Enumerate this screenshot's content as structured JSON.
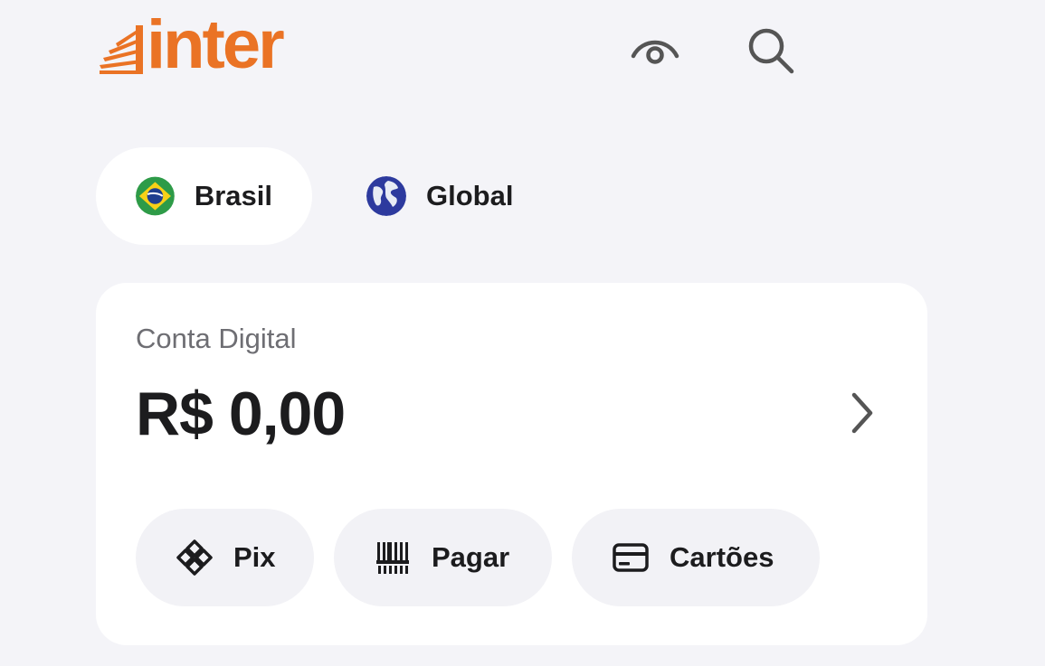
{
  "header": {
    "logo_text": "inter",
    "brand_color": "#EA7325",
    "icons": [
      "eye-icon",
      "search-icon"
    ]
  },
  "regions": [
    {
      "label": "Brasil",
      "icon": "brazil-flag-icon",
      "active": true
    },
    {
      "label": "Global",
      "icon": "globe-icon",
      "active": false
    }
  ],
  "account": {
    "title": "Conta Digital",
    "balance": "R$ 0,00",
    "chevron_icon": "chevron-right-icon"
  },
  "quick_actions": [
    {
      "label": "Pix",
      "icon": "pix-icon"
    },
    {
      "label": "Pagar",
      "icon": "barcode-icon"
    },
    {
      "label": "Cartões",
      "icon": "card-icon"
    }
  ],
  "colors": {
    "background": "#F4F4F8",
    "card": "#FFFFFF",
    "pill": "#F2F2F6",
    "text_primary": "#1C1C1E",
    "text_secondary": "#6E6E73"
  }
}
